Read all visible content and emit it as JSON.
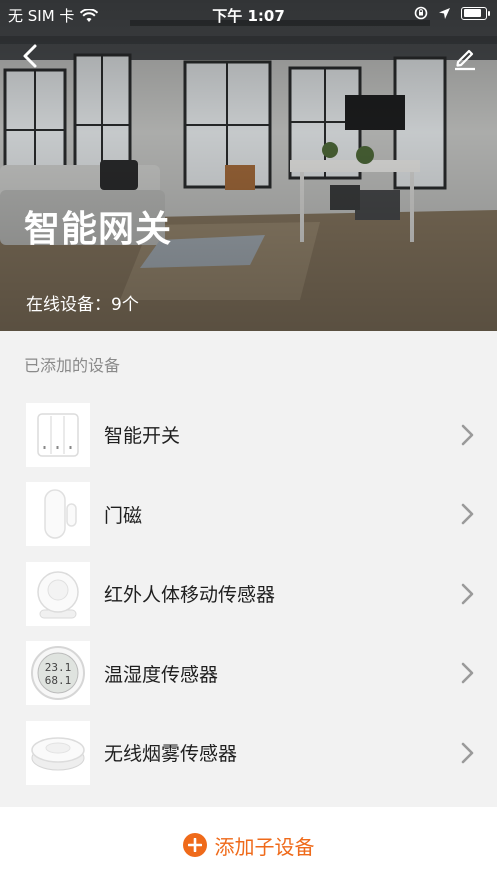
{
  "status_bar": {
    "carrier": "无 SIM 卡",
    "time": "下午 1:07",
    "icons": [
      "wifi-icon",
      "orientation-lock-icon",
      "location-icon",
      "battery-icon"
    ],
    "battery_level": 0.85
  },
  "header": {
    "back_icon": "chevron-left-icon",
    "edit_icon": "pencil-icon",
    "title": "智能网关",
    "online_devices": "在线设备：9个"
  },
  "devices_section": {
    "title": "已添加的设备",
    "items": [
      {
        "label": "智能开关",
        "icon": "smart-switch-icon"
      },
      {
        "label": "门磁",
        "icon": "door-sensor-icon"
      },
      {
        "label": "红外人体移动传感器",
        "icon": "motion-sensor-icon"
      },
      {
        "label": "温湿度传感器",
        "icon": "temp-humidity-sensor-icon"
      },
      {
        "label": "无线烟雾传感器",
        "icon": "smoke-sensor-icon"
      }
    ]
  },
  "temp_display": {
    "temp": "23.1",
    "humidity": "68.1"
  },
  "footer": {
    "add_label": "添加子设备",
    "add_icon": "plus-circle-icon"
  },
  "colors": {
    "accent": "#ef6a1a",
    "chevron": "#9a9a9a",
    "section_text": "#8a8a8a",
    "list_bg": "#f2f2f2"
  }
}
